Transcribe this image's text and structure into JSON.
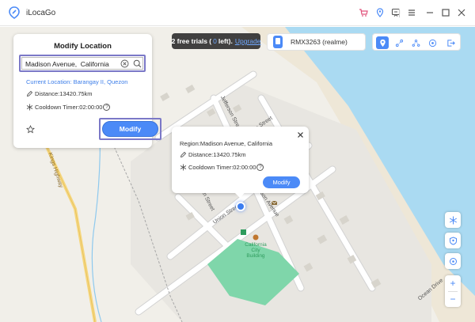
{
  "app": {
    "title": "iLocaGo"
  },
  "trial": {
    "prefix": "2 free trials (",
    "count": "0",
    "suffix": "left).",
    "upgrade": "Upgrade"
  },
  "device": {
    "name": "RMX3263 (realme)"
  },
  "panel": {
    "title": "Modify Location",
    "search_value": "Madison Avenue,  California",
    "current_location": "Current Location: Barangay II, Quezon",
    "distance": "Distance:13420.75km",
    "cooldown": "Cooldown Timer:02:00:00",
    "help": "?",
    "modify_label": "Modify"
  },
  "popup": {
    "region": "Region:Madison Avenue, California",
    "distance": "Distance:13420.75km",
    "cooldown": "Cooldown Timer:02:00:00",
    "help": "?",
    "modify_label": "Modify"
  },
  "map": {
    "streets": [
      "Jefferson Street",
      "Madison Street",
      "Nelson Street",
      "Madison Avenue",
      "Union Street",
      "Kings Highway",
      "Ocean Drive"
    ],
    "poi": [
      "California",
      "City Building"
    ]
  },
  "zoom": {
    "in": "+",
    "out": "−"
  },
  "colors": {
    "accent": "#4b8af7",
    "highlight": "#7b78c7",
    "water": "#aadaf2",
    "park": "#7fd6aa",
    "beach": "#eee7d7"
  }
}
